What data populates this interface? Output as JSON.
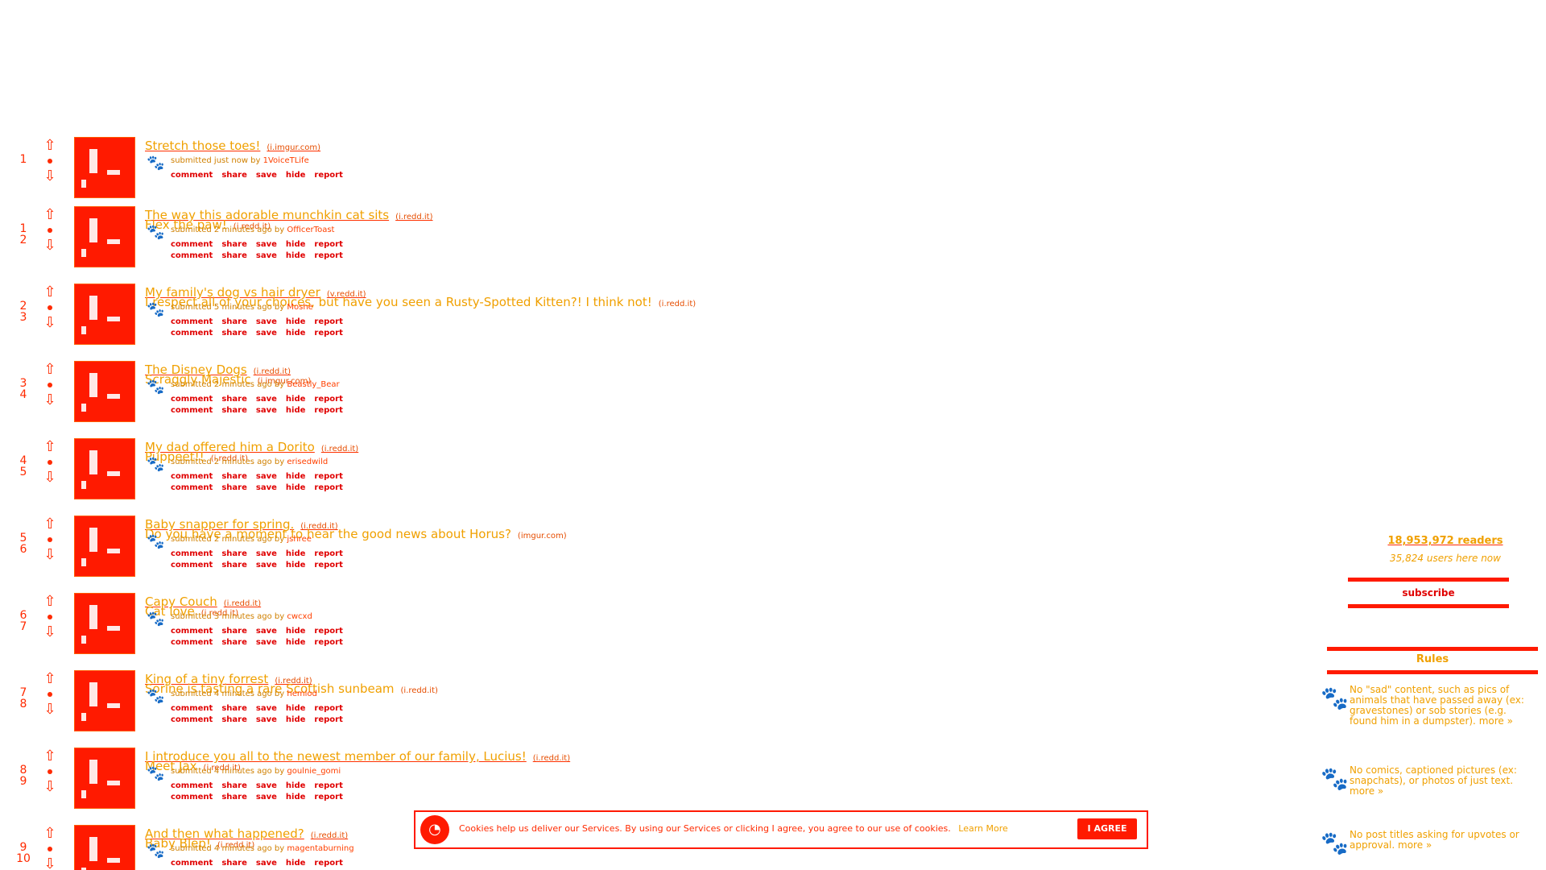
{
  "posts": [
    {
      "rank": "1",
      "title": "Stretch those toes!",
      "domain": "(i.imgur.com)",
      "tagline_pre": "submitted just now by ",
      "user": "1VoiceTLife",
      "title2": "",
      "domain2": ""
    },
    {
      "rank": "1",
      "rank2": "2",
      "title": "The way this adorable munchkin cat sits",
      "domain": "(i.redd.it)",
      "tagline_pre": "submitted 2 minutes ago by ",
      "user": "OfficerToast",
      "title2": "Flex the paw!",
      "domain2": "(i.redd.it)"
    },
    {
      "rank": "2",
      "rank2": "3",
      "title": "My family's dog vs hair dryer",
      "domain": "(v.redd.it)",
      "tagline_pre": "submitted 5 minutes ago by ",
      "user": "Moshe",
      "title2": "I respect all of your choices, but have you seen a Rusty-Spotted Kitten?! I think not!",
      "domain2": "(i.redd.it)"
    },
    {
      "rank": "3",
      "rank2": "4",
      "title": "The Disney Dogs",
      "domain": "(i.redd.it)",
      "tagline_pre": "submitted 2 minutes ago by ",
      "user": "Beastly_Bear",
      "title2": "Scraggly Majestic",
      "domain2": "(i.imgur.com)"
    },
    {
      "rank": "4",
      "rank2": "5",
      "title": "My dad offered him a Dorito",
      "domain": "(i.redd.it)",
      "tagline_pre": "submitted 2 minutes ago by ",
      "user": "erisedwild",
      "title2": "Puppeet!!",
      "domain2": "(i.redd.it)"
    },
    {
      "rank": "5",
      "rank2": "6",
      "title": "Baby snapper for spring.",
      "domain": "(i.redd.it)",
      "tagline_pre": "submitted 2 minutes ago by ",
      "user": "jshree",
      "title2": "Do you have a moment to hear the good news about Horus?",
      "domain2": "(imgur.com)"
    },
    {
      "rank": "6",
      "rank2": "7",
      "title": "Capy Couch",
      "domain": "(i.redd.it)",
      "tagline_pre": "submitted 3 minutes ago by ",
      "user": "cwcxd",
      "title2": "Cat love",
      "domain2": "(i.redd.it)"
    },
    {
      "rank": "7",
      "rank2": "8",
      "title": "King of a tiny forrest",
      "domain": "(i.redd.it)",
      "tagline_pre": "submitted 4 minutes ago by ",
      "user": "hemlod",
      "title2": "Sorine is tasting a rare Scottish sunbeam",
      "domain2": "(i.redd.it)"
    },
    {
      "rank": "8",
      "rank2": "9",
      "title": "I introduce you all to the newest member of our family, Lucius!",
      "domain": "(i.redd.it)",
      "tagline_pre": "submitted 4 minutes ago by ",
      "user": "goulnie_gomi",
      "title2": "Meet Jax",
      "domain2": "(i.redd.it)"
    },
    {
      "rank": "9",
      "rank2": "10",
      "title": "And then what happened?",
      "domain": "(i.redd.it)",
      "tagline_pre": "submitted 4 minutes ago by ",
      "user": "magentaburning",
      "title2": "Baby Blep!",
      "domain2": "(i.redd.it)"
    }
  ],
  "buttons": {
    "comment": "comment",
    "share": "share",
    "save": "save",
    "hide": "hide",
    "report": "report"
  },
  "sidebar": {
    "readers": "18,953,972 readers",
    "online": "35,824 users here now",
    "subscribe": "subscribe",
    "rules_title": "Rules",
    "rules": [
      "No \"sad\" content, such as pics of animals that have passed away (ex: gravestones) or sob stories (e.g. found him in a dumpster). more »",
      "No comics, captioned pictures (ex: snapchats), or photos of just text. more »",
      "No post titles asking for upvotes or approval. more »"
    ]
  },
  "cookie": {
    "text": "Cookies help us deliver our Services. By using our Services or clicking I agree, you agree to our use of cookies.",
    "learn_more": "Learn More",
    "agree": "I AGREE"
  }
}
